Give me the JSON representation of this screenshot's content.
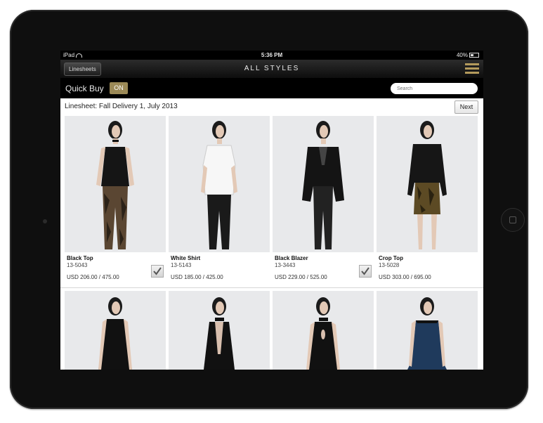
{
  "status_bar": {
    "device": "iPad",
    "time": "5:36 PM",
    "battery": "40%"
  },
  "nav": {
    "back_label": "Linesheets",
    "title": "ALL STYLES",
    "menu_icon": "hamburger-menu-icon"
  },
  "toolbar": {
    "quick_buy_label": "Quick Buy",
    "quick_buy_state": "ON",
    "search_placeholder": "Search"
  },
  "linesheet": {
    "title": "Linesheet: Fall Delivery 1, July 2013",
    "next_label": "Next"
  },
  "products": [
    {
      "name": "Black Top",
      "sku": "13-5043",
      "price": "USD 206.00 / 475.00",
      "checked": true
    },
    {
      "name": "White Shirt",
      "sku": "13-5143",
      "price": "USD 185.00 / 425.00",
      "checked": false
    },
    {
      "name": "Black Blazer",
      "sku": "13-3443",
      "price": "USD 229.00 / 525.00",
      "checked": true
    },
    {
      "name": "Crop Top",
      "sku": "13-5028",
      "price": "USD 303.00 / 695.00",
      "checked": false
    }
  ],
  "colors": {
    "accent_gold": "#9c8a57",
    "bar_black": "#000000"
  }
}
